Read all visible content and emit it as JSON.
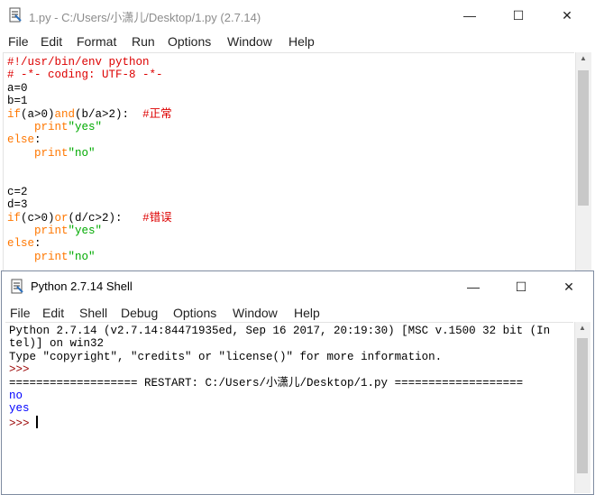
{
  "editor": {
    "title": "1.py - C:/Users/小潇儿/Desktop/1.py (2.7.14)",
    "controls": {
      "minimize": "—",
      "maximize": "☐",
      "close": "✕"
    },
    "menu": [
      "File",
      "Edit",
      "Format",
      "Run",
      "Options",
      "Window",
      "Help"
    ],
    "lines": [
      {
        "segments": [
          {
            "t": "#!/usr/bin/env python",
            "c": "comment"
          }
        ]
      },
      {
        "segments": [
          {
            "t": "# -*- coding: UTF-8 -*-",
            "c": "comment"
          }
        ]
      },
      {
        "segments": [
          {
            "t": "a=0",
            "c": "def"
          }
        ]
      },
      {
        "segments": [
          {
            "t": "b=1",
            "c": "def"
          }
        ]
      },
      {
        "segments": [
          {
            "t": "if",
            "c": "key"
          },
          {
            "t": "(a>0)",
            "c": "def"
          },
          {
            "t": "and",
            "c": "key"
          },
          {
            "t": "(b/a>2):  ",
            "c": "def"
          },
          {
            "t": "#正常",
            "c": "comment"
          }
        ]
      },
      {
        "segments": [
          {
            "t": "    ",
            "c": "def"
          },
          {
            "t": "print",
            "c": "key"
          },
          {
            "t": "\"yes\"",
            "c": "str"
          }
        ]
      },
      {
        "segments": [
          {
            "t": "else",
            "c": "key"
          },
          {
            "t": ":",
            "c": "def"
          }
        ]
      },
      {
        "segments": [
          {
            "t": "    ",
            "c": "def"
          },
          {
            "t": "print",
            "c": "key"
          },
          {
            "t": "\"no\"",
            "c": "str"
          }
        ]
      },
      {
        "segments": [
          {
            "t": "",
            "c": "def"
          }
        ]
      },
      {
        "segments": [
          {
            "t": "",
            "c": "def"
          }
        ]
      },
      {
        "segments": [
          {
            "t": "c=2",
            "c": "def"
          }
        ]
      },
      {
        "segments": [
          {
            "t": "d=3",
            "c": "def"
          }
        ]
      },
      {
        "segments": [
          {
            "t": "if",
            "c": "key"
          },
          {
            "t": "(c>0)",
            "c": "def"
          },
          {
            "t": "or",
            "c": "key"
          },
          {
            "t": "(d/c>2):   ",
            "c": "def"
          },
          {
            "t": "#错误",
            "c": "comment"
          }
        ]
      },
      {
        "segments": [
          {
            "t": "    ",
            "c": "def"
          },
          {
            "t": "print",
            "c": "key"
          },
          {
            "t": "\"yes\"",
            "c": "str"
          }
        ]
      },
      {
        "segments": [
          {
            "t": "else",
            "c": "key"
          },
          {
            "t": ":",
            "c": "def"
          }
        ]
      },
      {
        "segments": [
          {
            "t": "    ",
            "c": "def"
          },
          {
            "t": "print",
            "c": "key"
          },
          {
            "t": "\"no\"",
            "c": "str"
          }
        ]
      }
    ]
  },
  "shell": {
    "title": "Python 2.7.14 Shell",
    "controls": {
      "minimize": "—",
      "maximize": "☐",
      "close": "✕"
    },
    "menu": [
      "File",
      "Edit",
      "Shell",
      "Debug",
      "Options",
      "Window",
      "Help"
    ],
    "lines": [
      {
        "segments": [
          {
            "t": "Python 2.7.14 (v2.7.14:84471935ed, Sep 16 2017, 20:19:30) [MSC v.1500 32 bit (In",
            "c": "def"
          }
        ]
      },
      {
        "segments": [
          {
            "t": "tel)] on win32",
            "c": "def"
          }
        ]
      },
      {
        "segments": [
          {
            "t": "Type \"copyright\", \"credits\" or \"license()\" for more information.",
            "c": "def"
          }
        ]
      },
      {
        "segments": [
          {
            "t": ">>> ",
            "c": "prompt"
          }
        ]
      },
      {
        "segments": [
          {
            "t": "=================== RESTART: C:/Users/小潇儿/Desktop/1.py ===================",
            "c": "def"
          }
        ]
      },
      {
        "segments": [
          {
            "t": "no",
            "c": "out"
          }
        ]
      },
      {
        "segments": [
          {
            "t": "yes",
            "c": "out"
          }
        ]
      },
      {
        "segments": [
          {
            "t": ">>> ",
            "c": "prompt"
          }
        ],
        "cursor": true
      }
    ]
  }
}
